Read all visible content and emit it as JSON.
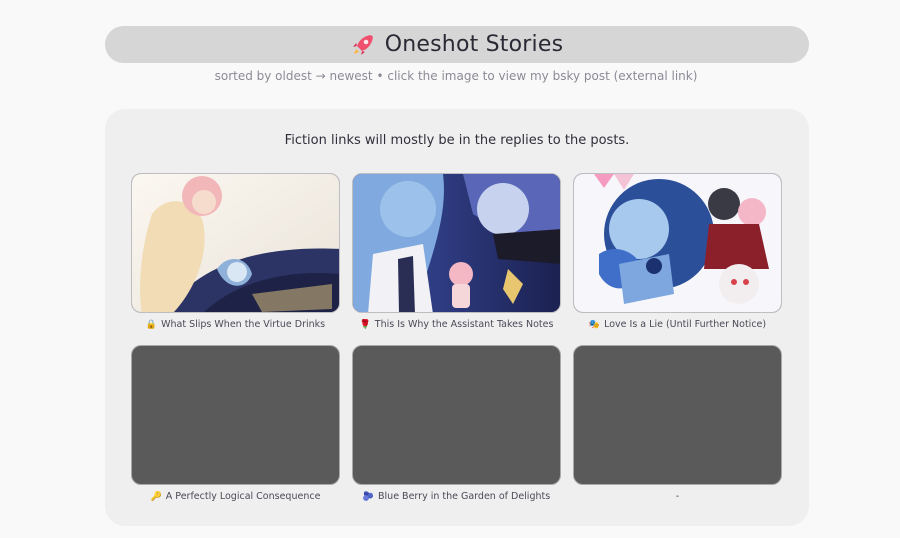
{
  "header": {
    "title": "Oneshot Stories",
    "icon": "rocket-icon"
  },
  "subtitle": "sorted by oldest → newest • click the image to view my bsky post (external link)",
  "intro": "Fiction links will mostly be in the replies to the posts.",
  "stories": [
    {
      "emoji": "🔒",
      "title": "What Slips When the Virtue Drinks"
    },
    {
      "emoji": "🌹",
      "title": "This Is Why the Assistant Takes Notes"
    },
    {
      "emoji": "🎭",
      "title": "Love Is a Lie (Until Further Notice)"
    },
    {
      "emoji": "🔑",
      "title": "A Perfectly Logical Consequence"
    },
    {
      "emoji": "🫐",
      "title": "Blue Berry in the Garden of Delights"
    },
    {
      "emoji": "",
      "title": "-"
    }
  ],
  "colors": {
    "page_bg": "#f9f9fa",
    "header_pill": "#d6d6d6",
    "card_bg": "#efeff0",
    "placeholder": "#5a5a5a",
    "text_dark": "#2a2a35",
    "text_muted": "#8b8b95"
  }
}
